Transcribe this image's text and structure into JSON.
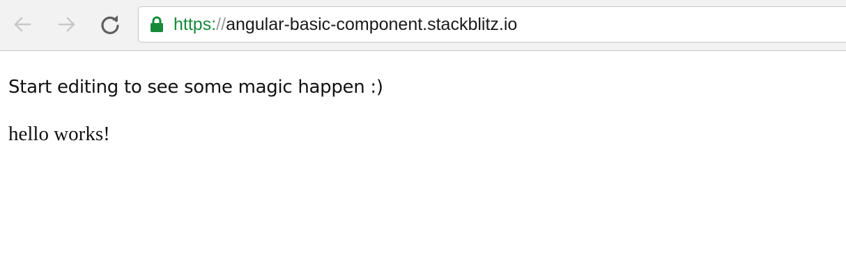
{
  "browser": {
    "back_icon": "arrow-left-icon",
    "forward_icon": "arrow-right-icon",
    "reload_icon": "reload-icon",
    "lock_icon": "lock-icon",
    "address": {
      "scheme": "https:",
      "separator": "//",
      "host": "angular-basic-component.stackblitz.io"
    },
    "colors": {
      "secure": "#168a3a",
      "disabled_nav": "#c8c8c8",
      "reload": "#5f5f5f"
    }
  },
  "page": {
    "heading": "Start editing to see some magic happen :)",
    "component_text": "hello works!"
  }
}
